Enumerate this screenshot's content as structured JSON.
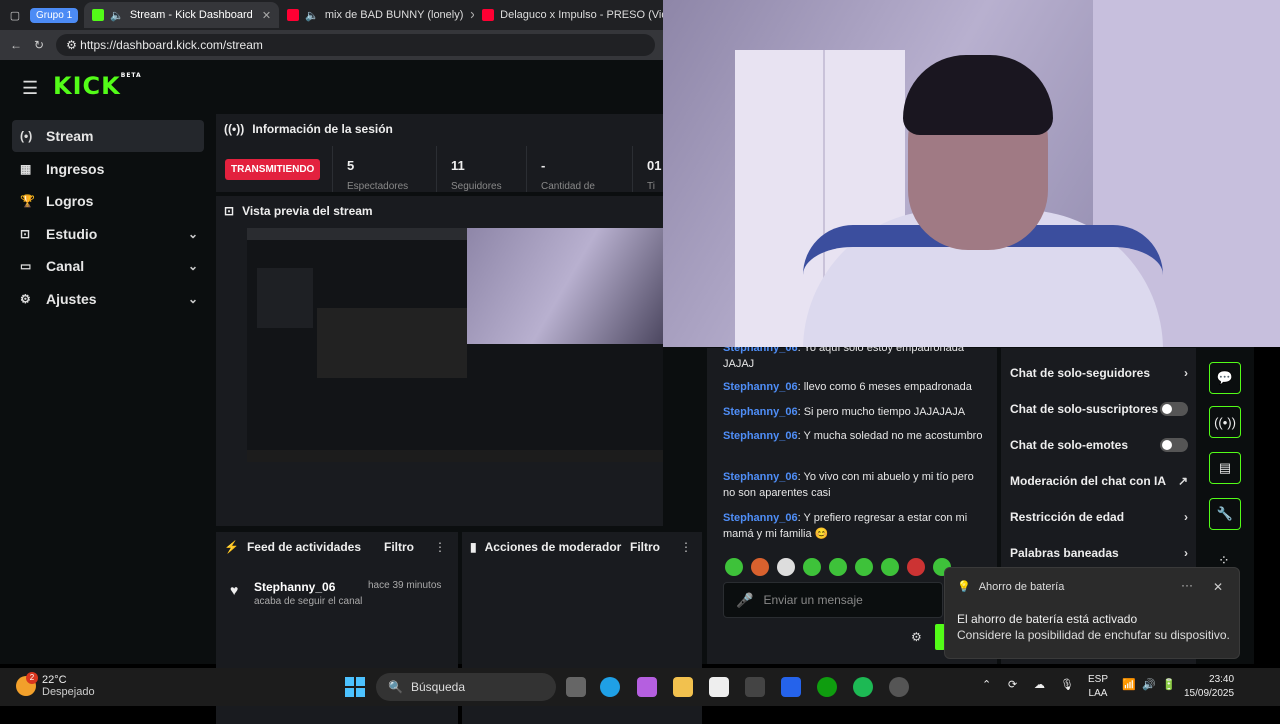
{
  "browser": {
    "group_chip": "Grupo 1",
    "tabs": [
      {
        "title": "Stream - Kick Dashboard",
        "active": true
      },
      {
        "title": "mix de BAD BUNNY (lonely)",
        "active": false
      },
      {
        "title": "Delaguco x Impulso - PRESO (Vid",
        "active": false
      }
    ],
    "url": "https://dashboard.kick.com/stream"
  },
  "kick": {
    "logo": "KICK",
    "logo_badge": "BETA",
    "sidebar": [
      {
        "label": "Stream",
        "icon": "stream-icon",
        "active": true,
        "expandable": false
      },
      {
        "label": "Ingresos",
        "icon": "revenue-icon",
        "active": false,
        "expandable": false
      },
      {
        "label": "Logros",
        "icon": "trophy-icon",
        "active": false,
        "expandable": false
      },
      {
        "label": "Estudio",
        "icon": "studio-icon",
        "active": false,
        "expandable": true
      },
      {
        "label": "Canal",
        "icon": "channel-icon",
        "active": false,
        "expandable": true
      },
      {
        "label": "Ajustes",
        "icon": "settings-icon",
        "active": false,
        "expandable": true
      }
    ],
    "session": {
      "title": "Información de la sesión",
      "live_badge": "TRANSMITIENDO",
      "stats": [
        {
          "value": "5",
          "label": "Espectadores"
        },
        {
          "value": "11",
          "label": "Seguidores"
        },
        {
          "value": "-",
          "label": "Cantidad de"
        },
        {
          "value": "01",
          "label": "Ti"
        }
      ]
    },
    "preview": {
      "title": "Vista previa del stream"
    },
    "feed": {
      "title": "Feed de actividades",
      "filter": "Filtro",
      "items": [
        {
          "user": "Stephanny_06",
          "time": "hace 39 minutos",
          "desc": "acaba de seguir el canal"
        }
      ]
    },
    "mod": {
      "title": "Acciones de moderador",
      "filter": "Filtro"
    },
    "chat": {
      "messages": [
        {
          "user": "Stephanny_06",
          "text": ": Yo aquí solo estoy empadronada JAJAJ"
        },
        {
          "user": "Stephanny_06",
          "text": ": llevo como 6 meses empadronada"
        },
        {
          "user": "Stephanny_06",
          "text": ": Si pero mucho tiempo JAJAJAJA"
        },
        {
          "user": "Stephanny_06",
          "text": ": Y mucha soledad no me acostumbro"
        },
        {
          "user": "Stephanny_06",
          "text": ": Yo vivo con mi abuelo y mi tío pero no son aparentes casi"
        },
        {
          "user": "Stephanny_06",
          "text": ": Y prefiero regresar a estar con mi mamá y mi familia 😊"
        }
      ],
      "input_placeholder": "Enviar un mensaje"
    },
    "chat_settings": [
      {
        "label": "Chat de solo-seguidores",
        "control": "chevron"
      },
      {
        "label": "Chat de solo-suscriptores",
        "control": "toggle"
      },
      {
        "label": "Chat de solo-emotes",
        "control": "toggle"
      },
      {
        "label": "Moderación del chat con IA",
        "control": "external"
      },
      {
        "label": "Restricción de edad",
        "control": "chevron"
      },
      {
        "label": "Palabras baneadas",
        "control": "chevron"
      }
    ]
  },
  "notification": {
    "app": "Ahorro de batería",
    "line1": "El ahorro de batería está activado",
    "line2": "Considere la posibilidad de enchufar su dispositivo."
  },
  "taskbar": {
    "weather_temp": "22°C",
    "weather_desc": "Despejado",
    "weather_badge": "2",
    "search": "Búsqueda",
    "lang_top": "ESP",
    "lang_bottom": "LAA",
    "time": "23:40",
    "date": "15/09/2025"
  },
  "colors": {
    "kick_green": "#53fc18",
    "live_red": "#e3213e",
    "chat_user": "#4f8ef7"
  }
}
